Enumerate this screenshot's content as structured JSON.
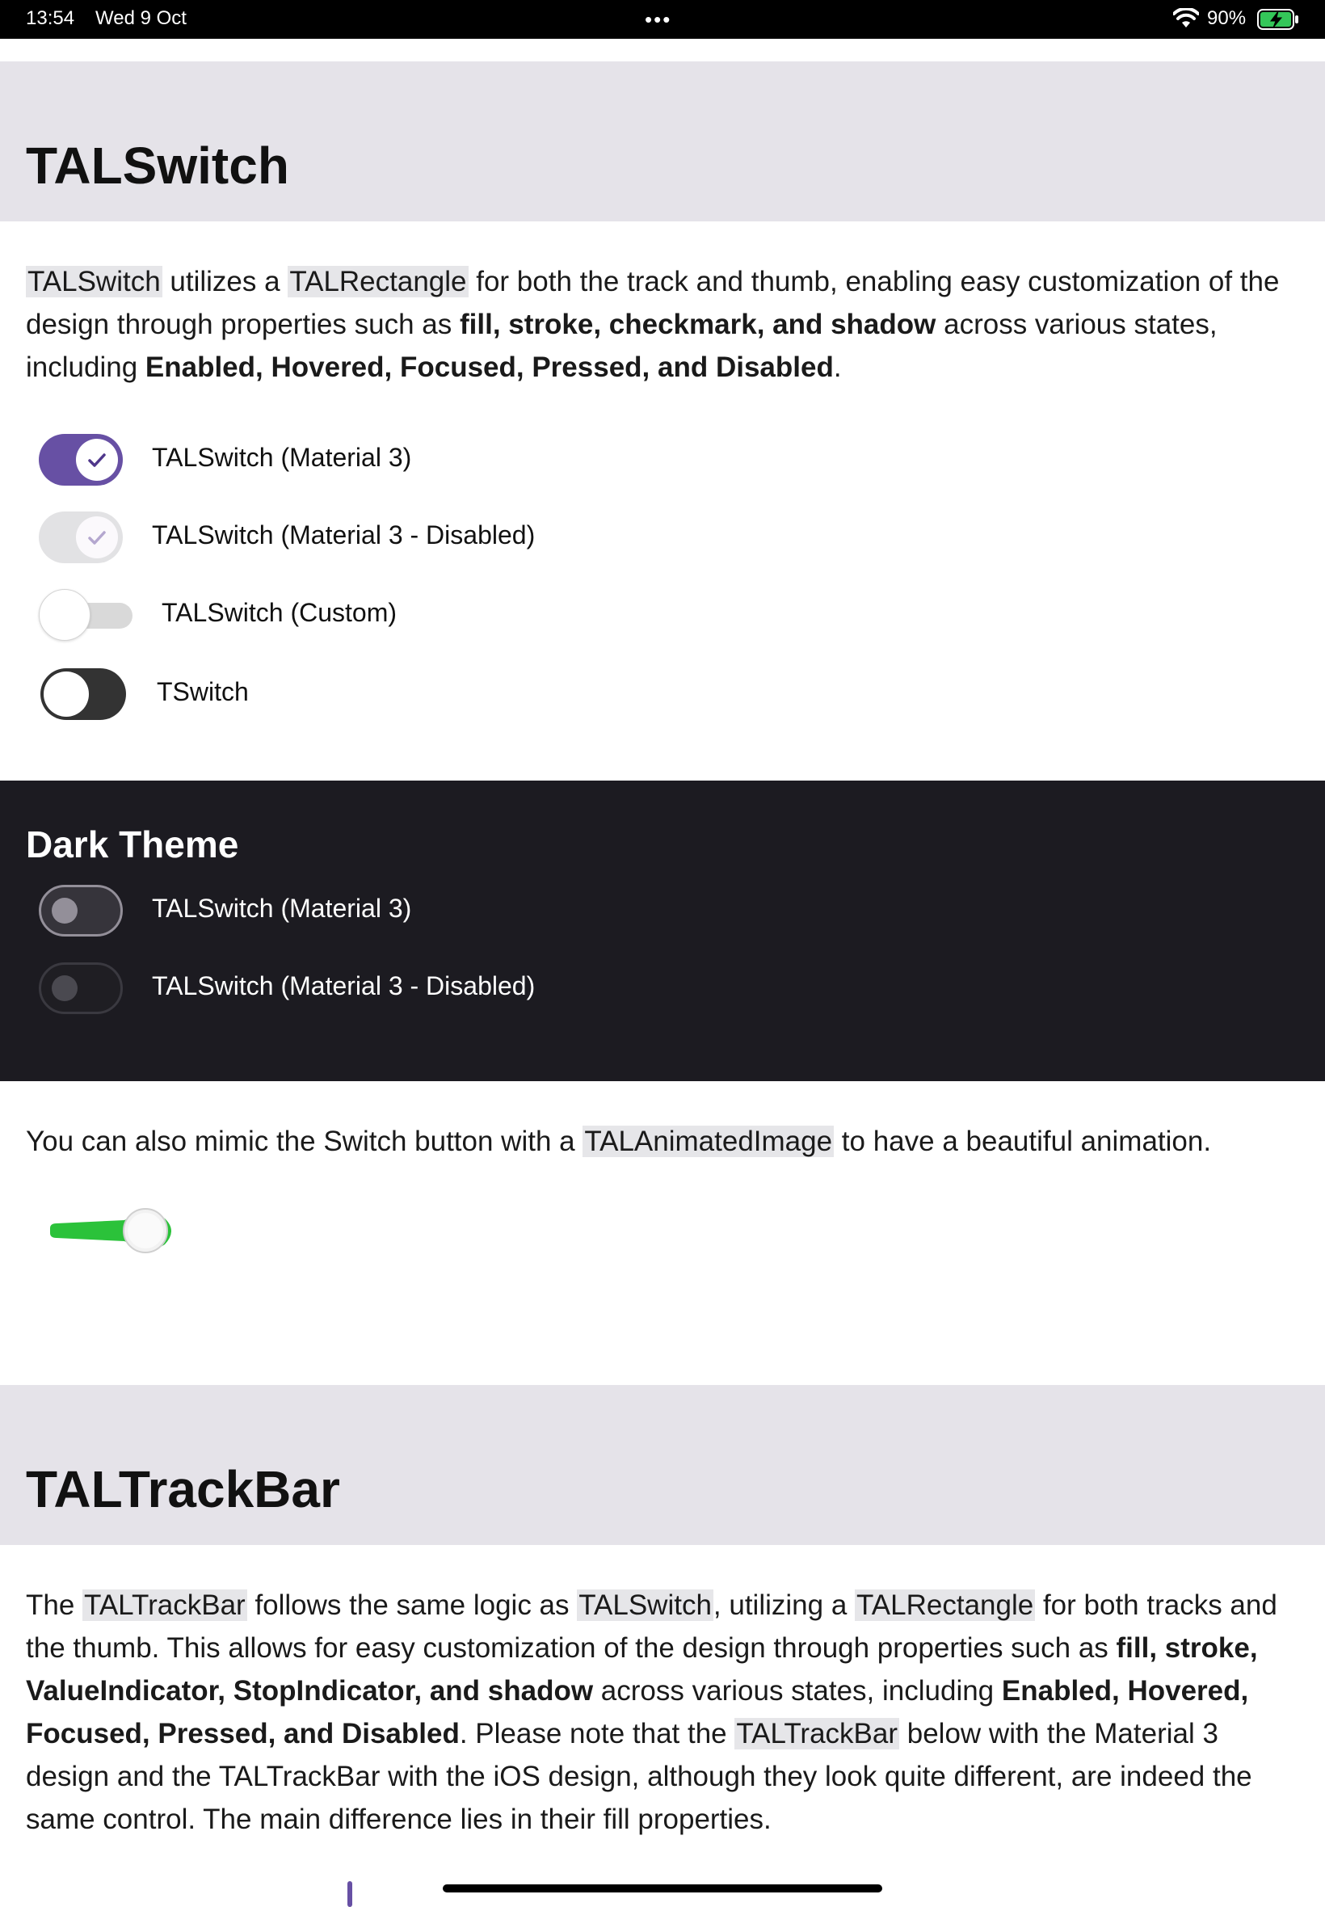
{
  "status_bar": {
    "time": "13:54",
    "date": "Wed 9 Oct",
    "dots": "•••",
    "battery_percent": "90%",
    "icons": [
      "wifi-icon",
      "battery-charging-icon"
    ]
  },
  "switch_section": {
    "title": "TALSwitch",
    "description": {
      "c1": "TALSwitch",
      "t1": " utilizes a ",
      "c2": "TALRectangle",
      "t2": " for both the track and thumb, enabling easy customization of the design through properties such as ",
      "b1": "fill, stroke, checkmark, and shadow",
      "t3": " across various states, including ",
      "b2": "Enabled, Hovered, Focused, Pressed, and Disabled",
      "t4": "."
    },
    "switches": [
      {
        "label": "TALSwitch (Material 3)",
        "checked": true,
        "enabled": true
      },
      {
        "label": "TALSwitch (Material 3 - Disabled)",
        "checked": true,
        "enabled": false
      },
      {
        "label": "TALSwitch (Custom)",
        "checked": false,
        "enabled": true
      },
      {
        "label": "TSwitch",
        "checked": false,
        "enabled": true
      }
    ]
  },
  "dark_theme": {
    "title": "Dark Theme",
    "switches": [
      {
        "label": "TALSwitch (Material 3)",
        "checked": false,
        "enabled": true
      },
      {
        "label": "TALSwitch (Material 3 - Disabled)",
        "checked": false,
        "enabled": false
      }
    ]
  },
  "animated": {
    "t1": "You can also mimic the Switch button with a ",
    "c1": "TALAnimatedImage",
    "t2": " to have a beautiful animation."
  },
  "trackbar_section": {
    "title": "TALTrackBar",
    "description": {
      "t0": "The ",
      "c1": "TALTrackBar",
      "t1": " follows the same logic as ",
      "c2": "TALSwitch",
      "t2": ", utilizing a ",
      "c3": "TALRectangle",
      "t3": " for both tracks and the thumb. This allows for easy customization of the design through properties such as ",
      "b1": "fill, stroke, ValueIndicator, StopIndicator, and shadow",
      "t4": " across various states, including ",
      "b2": "Enabled, Hovered, Focused, Pressed, and Disabled",
      "t5": ". Please note that the ",
      "c4": "TALTrackBar",
      "t6": " below with the Material 3 design and the TALTrackBar with the iOS design, although they look quite different, are indeed the same control. The main difference lies in their fill properties."
    }
  },
  "colors": {
    "header_bg": "#e5e3e9",
    "accent": "#6750a4",
    "dark_bg": "#1c1b21",
    "green": "#2bc23a"
  }
}
